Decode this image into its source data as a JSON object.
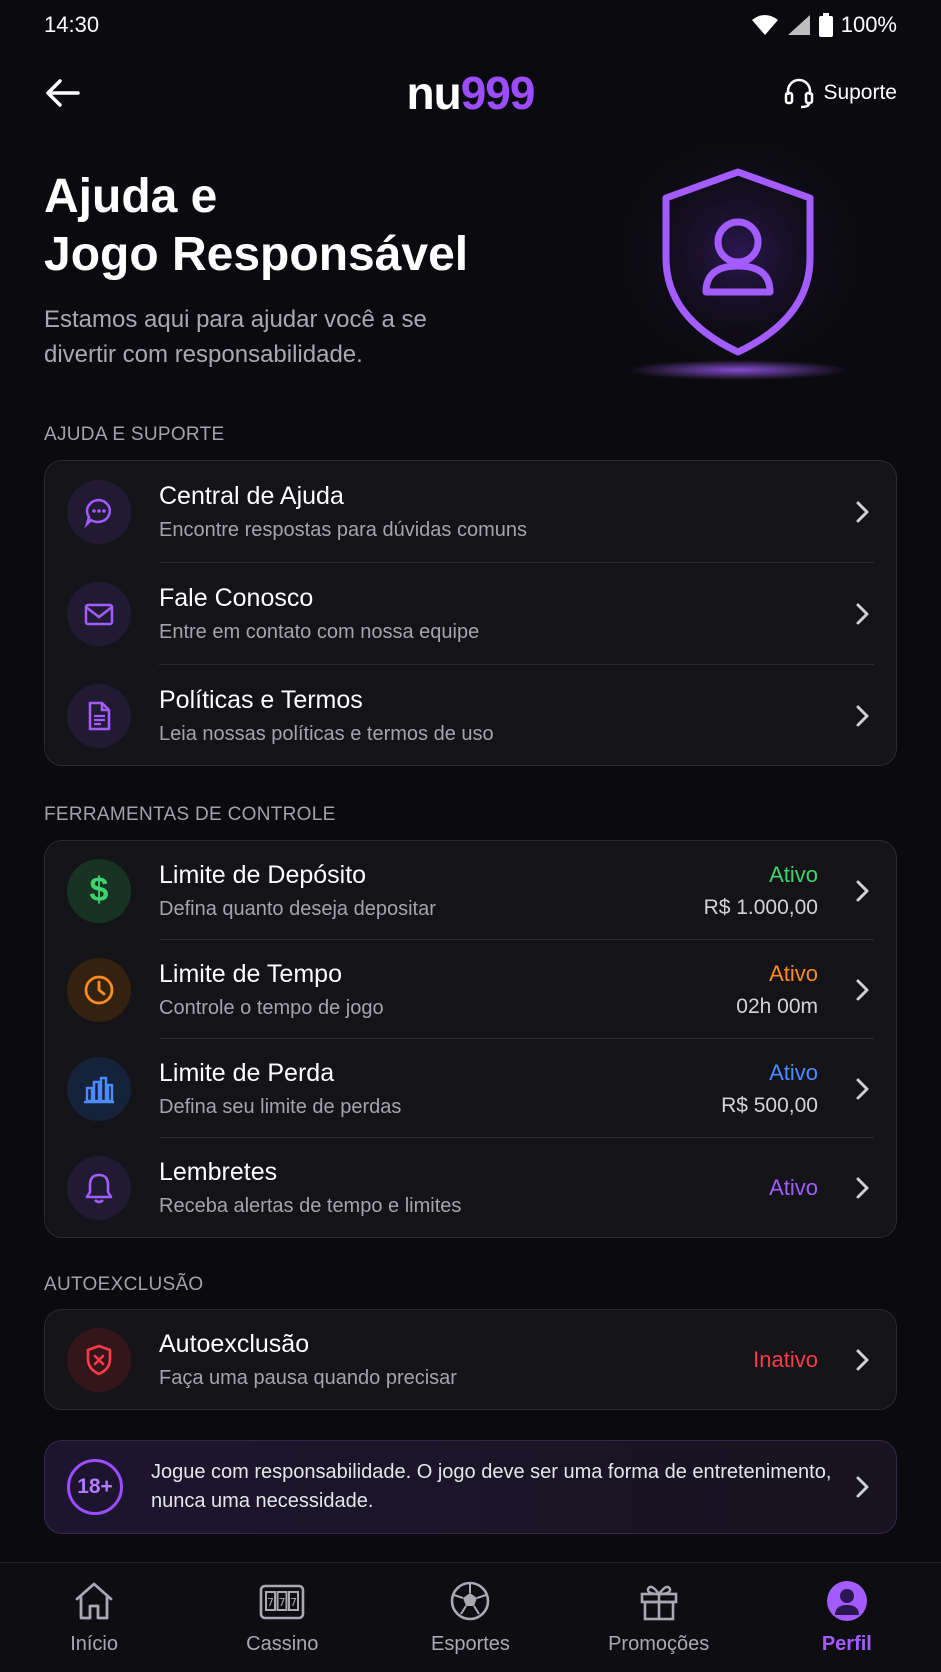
{
  "status_bar": {
    "time": "14:30",
    "battery": "100%"
  },
  "header": {
    "logo_a": "nu",
    "logo_b": "999",
    "support_label": "Suporte"
  },
  "hero": {
    "title_line1": "Ajuda e",
    "title_line2": "Jogo Responsável",
    "subtitle": "Estamos aqui para ajudar você a se divertir com responsabilidade."
  },
  "help_section": {
    "label": "AJUDA E SUPORTE",
    "items": [
      {
        "title": "Central de Ajuda",
        "subtitle": "Encontre respostas para dúvidas comuns",
        "icon": "chat-bubble-icon"
      },
      {
        "title": "Fale Conosco",
        "subtitle": "Entre em contato com nossa equipe",
        "icon": "envelope-icon"
      },
      {
        "title": "Políticas e Termos",
        "subtitle": "Leia nossas políticas e termos de uso",
        "icon": "document-icon"
      }
    ]
  },
  "tools_section": {
    "label": "FERRAMENTAS DE CONTROLE",
    "items": [
      {
        "title": "Limite de Depósito",
        "subtitle": "Defina quanto deseja depositar",
        "status": "Ativo",
        "value": "R$ 1.000,00",
        "color": "#3fd36b",
        "icon": "dollar-icon"
      },
      {
        "title": "Limite de Tempo",
        "subtitle": "Controle o tempo de jogo",
        "status": "Ativo",
        "value": "02h 00m",
        "color": "#ff8a1f",
        "icon": "clock-icon"
      },
      {
        "title": "Limite de Perda",
        "subtitle": "Defina seu limite de perdas",
        "status": "Ativo",
        "value": "R$ 500,00",
        "color": "#4a8cff",
        "icon": "bar-chart-icon"
      },
      {
        "title": "Lembretes",
        "subtitle": "Receba alertas de tempo e limites",
        "status": "Ativo",
        "value": "",
        "color": "#a35cff",
        "icon": "bell-icon"
      }
    ]
  },
  "exclusion_section": {
    "label": "AUTOEXCLUSÃO",
    "item": {
      "title": "Autoexclusão",
      "subtitle": "Faça uma pausa quando precisar",
      "status": "Inativo",
      "color": "#ff3b4a",
      "icon": "shield-x-icon"
    }
  },
  "banner": {
    "badge": "18+",
    "text": "Jogue com responsabilidade. O jogo deve ser uma forma de entretenimento, nunca uma necessidade."
  },
  "bottom_nav": [
    {
      "label": "Início",
      "icon": "home-icon"
    },
    {
      "label": "Cassino",
      "icon": "slot-machine-icon"
    },
    {
      "label": "Esportes",
      "icon": "soccer-ball-icon"
    },
    {
      "label": "Promoções",
      "icon": "gift-icon"
    },
    {
      "label": "Perfil",
      "icon": "profile-icon",
      "active": true
    }
  ],
  "colors": {
    "accent": "#9b4dff",
    "background": "#0b0b0f",
    "card": "#131318"
  }
}
